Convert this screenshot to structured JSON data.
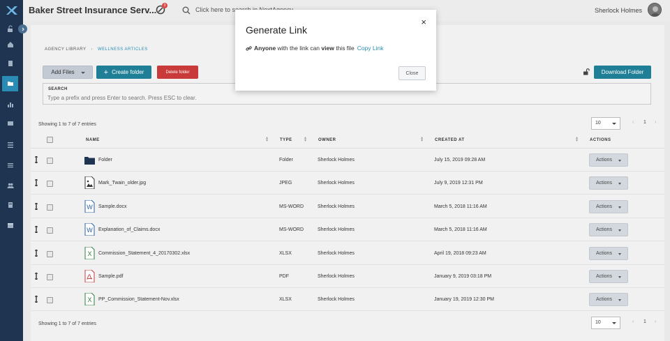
{
  "app": {
    "title": "Baker Street Insurance Serv...",
    "notification_count": "3",
    "search_placeholder": "Click here to search in NextAgency",
    "user_name": "Sherlock Holmes"
  },
  "breadcrumb": [
    "AGENCY LIBRARY",
    "WELLNESS ARTICLES"
  ],
  "toolbar": {
    "add_files": "Add Files",
    "create_folder": "Create folder",
    "delete_folder": "Delete folder",
    "download_folder": "Download Folder"
  },
  "search": {
    "label": "SEARCH",
    "placeholder": "Type a prefix and press Enter to search. Press ESC to clear."
  },
  "entries_text": "Showing 1 to 7 of 7 entries",
  "page_size": "10",
  "pager": {
    "prev": "‹",
    "page": "1",
    "next": "›"
  },
  "columns": [
    "NAME",
    "TYPE",
    "OWNER",
    "CREATED AT",
    "ACTIONS"
  ],
  "rows": [
    {
      "name": "Folder",
      "type": "Folder",
      "owner": "Sherlock Holmes",
      "created": "July 15, 2019 09:28 AM",
      "action": "Actions",
      "icon": "folder-icon"
    },
    {
      "name": "Mark_Twain_older.jpg",
      "type": "JPEG",
      "owner": "Sherlock Holmes",
      "created": "July 9, 2019 12:31 PM",
      "action": "Actions",
      "icon": "image-file-icon"
    },
    {
      "name": "Sample.docx",
      "type": "MS-WORD",
      "owner": "Sherlock Holmes",
      "created": "March 5, 2018 11:16 AM",
      "action": "Actions",
      "icon": "word-file-icon"
    },
    {
      "name": "Explanation_of_Claims.docx",
      "type": "MS-WORD",
      "owner": "Sherlock Holmes",
      "created": "March 5, 2018 11:16 AM",
      "action": "Actions",
      "icon": "word-file-icon"
    },
    {
      "name": "Commission_Statement_4_20170302.xlsx",
      "type": "XLSX",
      "owner": "Sherlock Holmes",
      "created": "April 19, 2018 09:23 AM",
      "action": "Actions",
      "icon": "excel-file-icon"
    },
    {
      "name": "Sample.pdf",
      "type": "PDF",
      "owner": "Sherlock Holmes",
      "created": "January 9, 2019 03:18 PM",
      "action": "Actions",
      "icon": "pdf-file-icon"
    },
    {
      "name": "PP_Commission_Statement-Nov.xlsx",
      "type": "XLSX",
      "owner": "Sherlock Holmes",
      "created": "January 19, 2019 12:30 PM",
      "action": "Actions",
      "icon": "excel-file-icon"
    }
  ],
  "modal": {
    "title": "Generate Link",
    "close_x": "×",
    "text_anyone": "Anyone",
    "text_mid": "with the link can",
    "text_view": "view",
    "text_end": "this file",
    "copy_link": "Copy Link",
    "close_button": "Close"
  },
  "colors": {
    "sidebar": "#1e3450",
    "accent": "#1f7f96",
    "danger": "#c93a3a",
    "link": "#2a8cb5"
  }
}
